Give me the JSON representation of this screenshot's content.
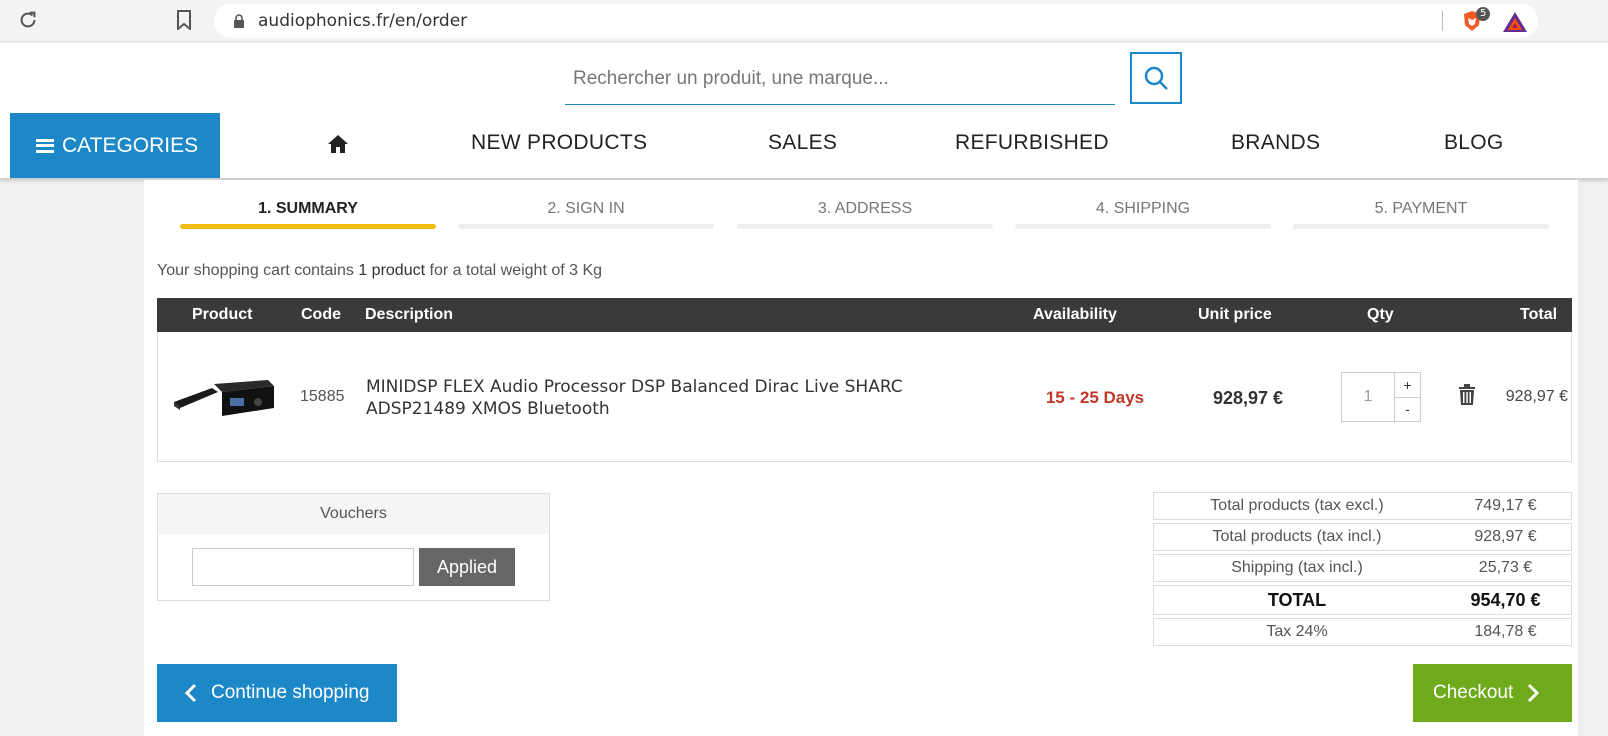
{
  "browser": {
    "url": "audiophonics.fr/en/order",
    "shield_badge": "5"
  },
  "header": {
    "search_placeholder": "Rechercher un produit, une marque...",
    "categories_label": "CATEGORIES",
    "nav": {
      "new_products": "NEW PRODUCTS",
      "sales": "SALES",
      "refurbished": "REFURBISHED",
      "brands": "BRANDS",
      "blog": "BLOG"
    }
  },
  "steps": [
    {
      "label": "1. SUMMARY",
      "active": true
    },
    {
      "label": "2. SIGN IN",
      "active": false
    },
    {
      "label": "3. ADDRESS",
      "active": false
    },
    {
      "label": "4. SHIPPING",
      "active": false
    },
    {
      "label": "5. PAYMENT",
      "active": false
    }
  ],
  "cart": {
    "summary_prefix": "Your shopping cart contains ",
    "summary_count": "1 product",
    "summary_suffix": " for a total weight of 3 Kg",
    "headers": {
      "product": "Product",
      "code": "Code",
      "description": "Description",
      "availability": "Availability",
      "unit_price": "Unit price",
      "qty": "Qty",
      "total": "Total"
    },
    "items": [
      {
        "code": "15885",
        "description": "MINIDSP FLEX Audio Processor DSP Balanced Dirac Live SHARC ADSP21489 XMOS Bluetooth",
        "availability": "15 - 25 Days",
        "unit_price": "928,97 €",
        "qty": "1",
        "total": "928,97 €"
      }
    ]
  },
  "vouchers": {
    "title": "Vouchers",
    "button_label": "Applied"
  },
  "totals": {
    "rows": [
      {
        "label": "Total products (tax excl.)",
        "value": "749,17 €"
      },
      {
        "label": "Total products (tax incl.)",
        "value": "928,97 €"
      },
      {
        "label": "Shipping (tax incl.)",
        "value": "25,73 €"
      },
      {
        "label": "TOTAL",
        "value": "954,70 €"
      },
      {
        "label": "Tax 24%",
        "value": "184,78 €"
      }
    ]
  },
  "buttons": {
    "continue": "Continue shopping",
    "checkout": "Checkout"
  },
  "colors": {
    "brand_blue": "#1c88c7",
    "active_step": "#f0be0f",
    "availability_red": "#c0392b",
    "checkout_green": "#6eaa1c"
  },
  "icons": [
    "reload-icon",
    "bookmark-icon",
    "lock-icon",
    "brave-shield-icon",
    "bat-icon",
    "search-icon",
    "menu-icon",
    "home-icon",
    "trash-icon",
    "chevron-left-icon",
    "chevron-right-icon"
  ]
}
